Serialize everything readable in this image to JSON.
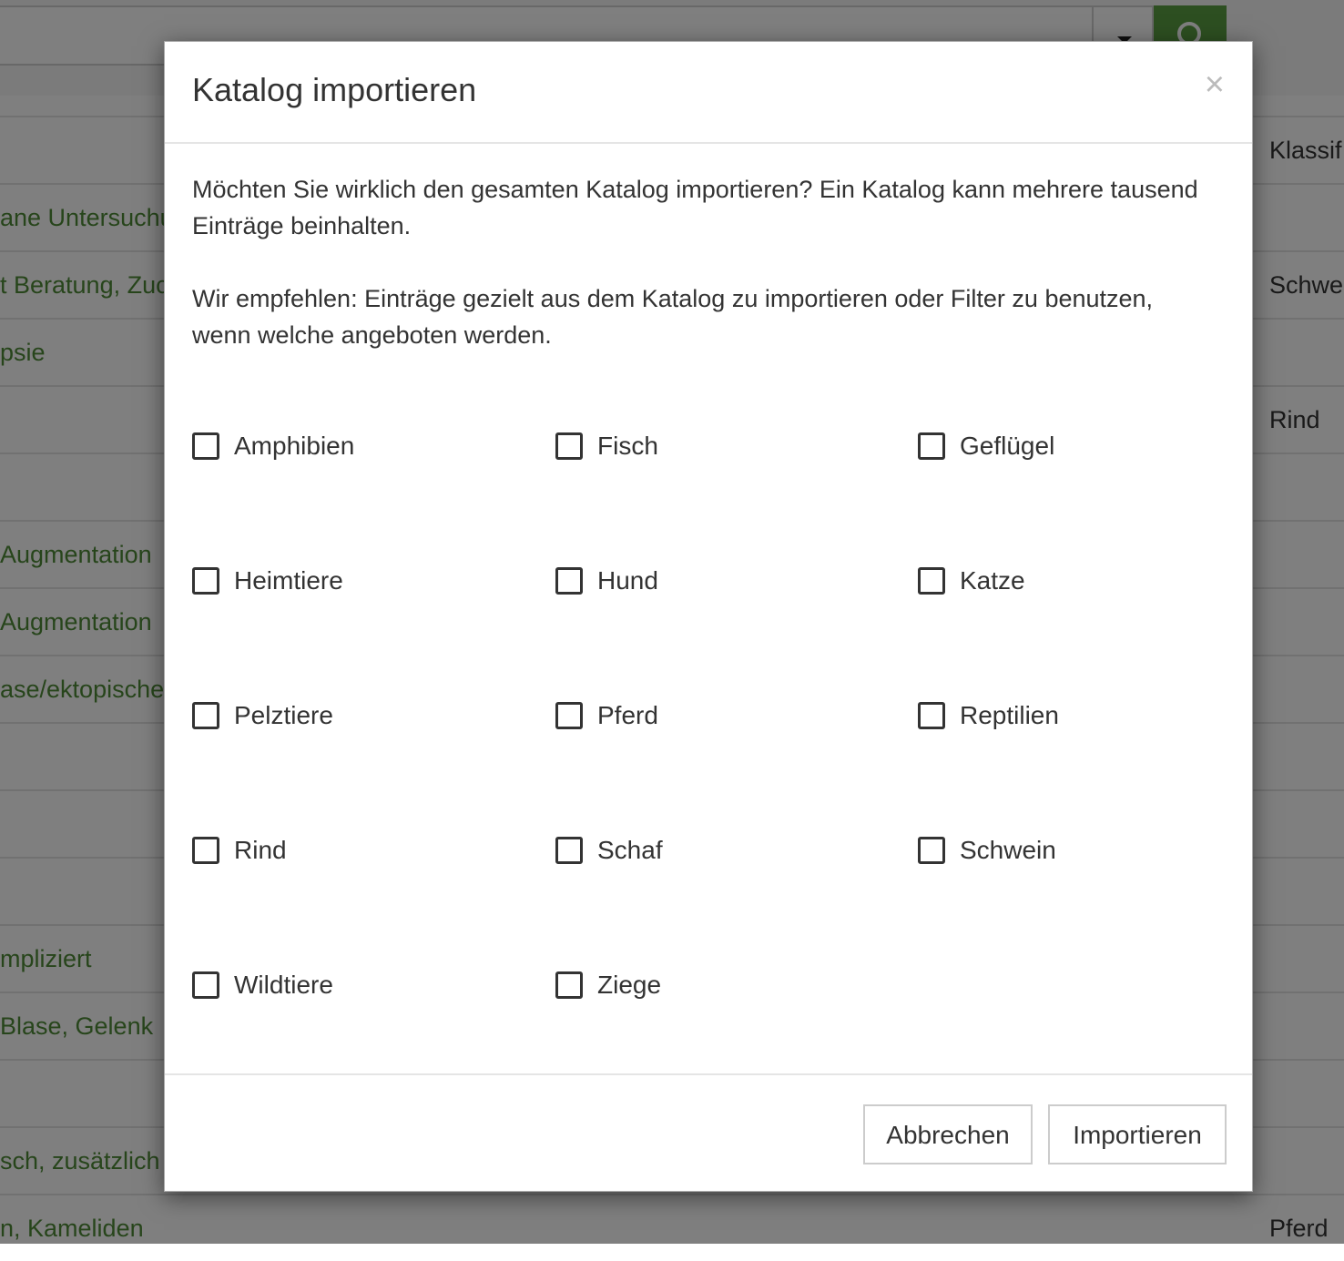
{
  "background": {
    "search_placeholder": "",
    "table": {
      "header_right": "Klassif",
      "rows": [
        {
          "left": "ane Untersuchu",
          "right": ""
        },
        {
          "left": "t Beratung, Zuc",
          "right": "Schwe"
        },
        {
          "left": "psie",
          "right": ""
        },
        {
          "left": "",
          "right": "Rind"
        },
        {
          "left": "",
          "right": ""
        },
        {
          "left": " Augmentation",
          "right": ""
        },
        {
          "left": " Augmentation",
          "right": ""
        },
        {
          "left": "ase/ektopische",
          "right": ""
        },
        {
          "left": "",
          "right": ""
        },
        {
          "left": "",
          "right": ""
        },
        {
          "left": "",
          "right": ""
        },
        {
          "left": "mpliziert",
          "right": ""
        },
        {
          "left": "Blase, Gelenk",
          "right": ""
        },
        {
          "left": "",
          "right": ""
        },
        {
          "left": "sch, zusätzlich",
          "right": ""
        },
        {
          "left": "n, Kameliden",
          "right": "Pferd"
        }
      ]
    }
  },
  "modal": {
    "title": "Katalog importieren",
    "close_symbol": "×",
    "paragraph1": "Möchten Sie wirklich den gesamten Katalog importieren? Ein Katalog kann mehrere tausend Einträge beinhalten.",
    "paragraph2": "Wir empfehlen: Einträge gezielt aus dem Katalog zu importieren oder Filter zu benutzen, wenn welche angeboten werden.",
    "checkboxes": [
      {
        "label": "Amphibien",
        "checked": false
      },
      {
        "label": "Fisch",
        "checked": false
      },
      {
        "label": "Geflügel",
        "checked": false
      },
      {
        "label": "Heimtiere",
        "checked": false
      },
      {
        "label": "Hund",
        "checked": false
      },
      {
        "label": "Katze",
        "checked": false
      },
      {
        "label": "Pelztiere",
        "checked": false
      },
      {
        "label": "Pferd",
        "checked": false
      },
      {
        "label": "Reptilien",
        "checked": false
      },
      {
        "label": "Rind",
        "checked": false
      },
      {
        "label": "Schaf",
        "checked": false
      },
      {
        "label": "Schwein",
        "checked": false
      },
      {
        "label": "Wildtiere",
        "checked": false
      },
      {
        "label": "Ziege",
        "checked": false
      }
    ],
    "buttons": {
      "cancel": "Abbrechen",
      "import": "Importieren"
    }
  },
  "colors": {
    "brand_green": "#5a9e42",
    "link_green": "#4e8a37",
    "overlay": "rgba(0,0,0,0.5)"
  },
  "icons": {
    "search": "search-icon",
    "dropdown": "chevron-down-icon",
    "close": "close-icon"
  }
}
